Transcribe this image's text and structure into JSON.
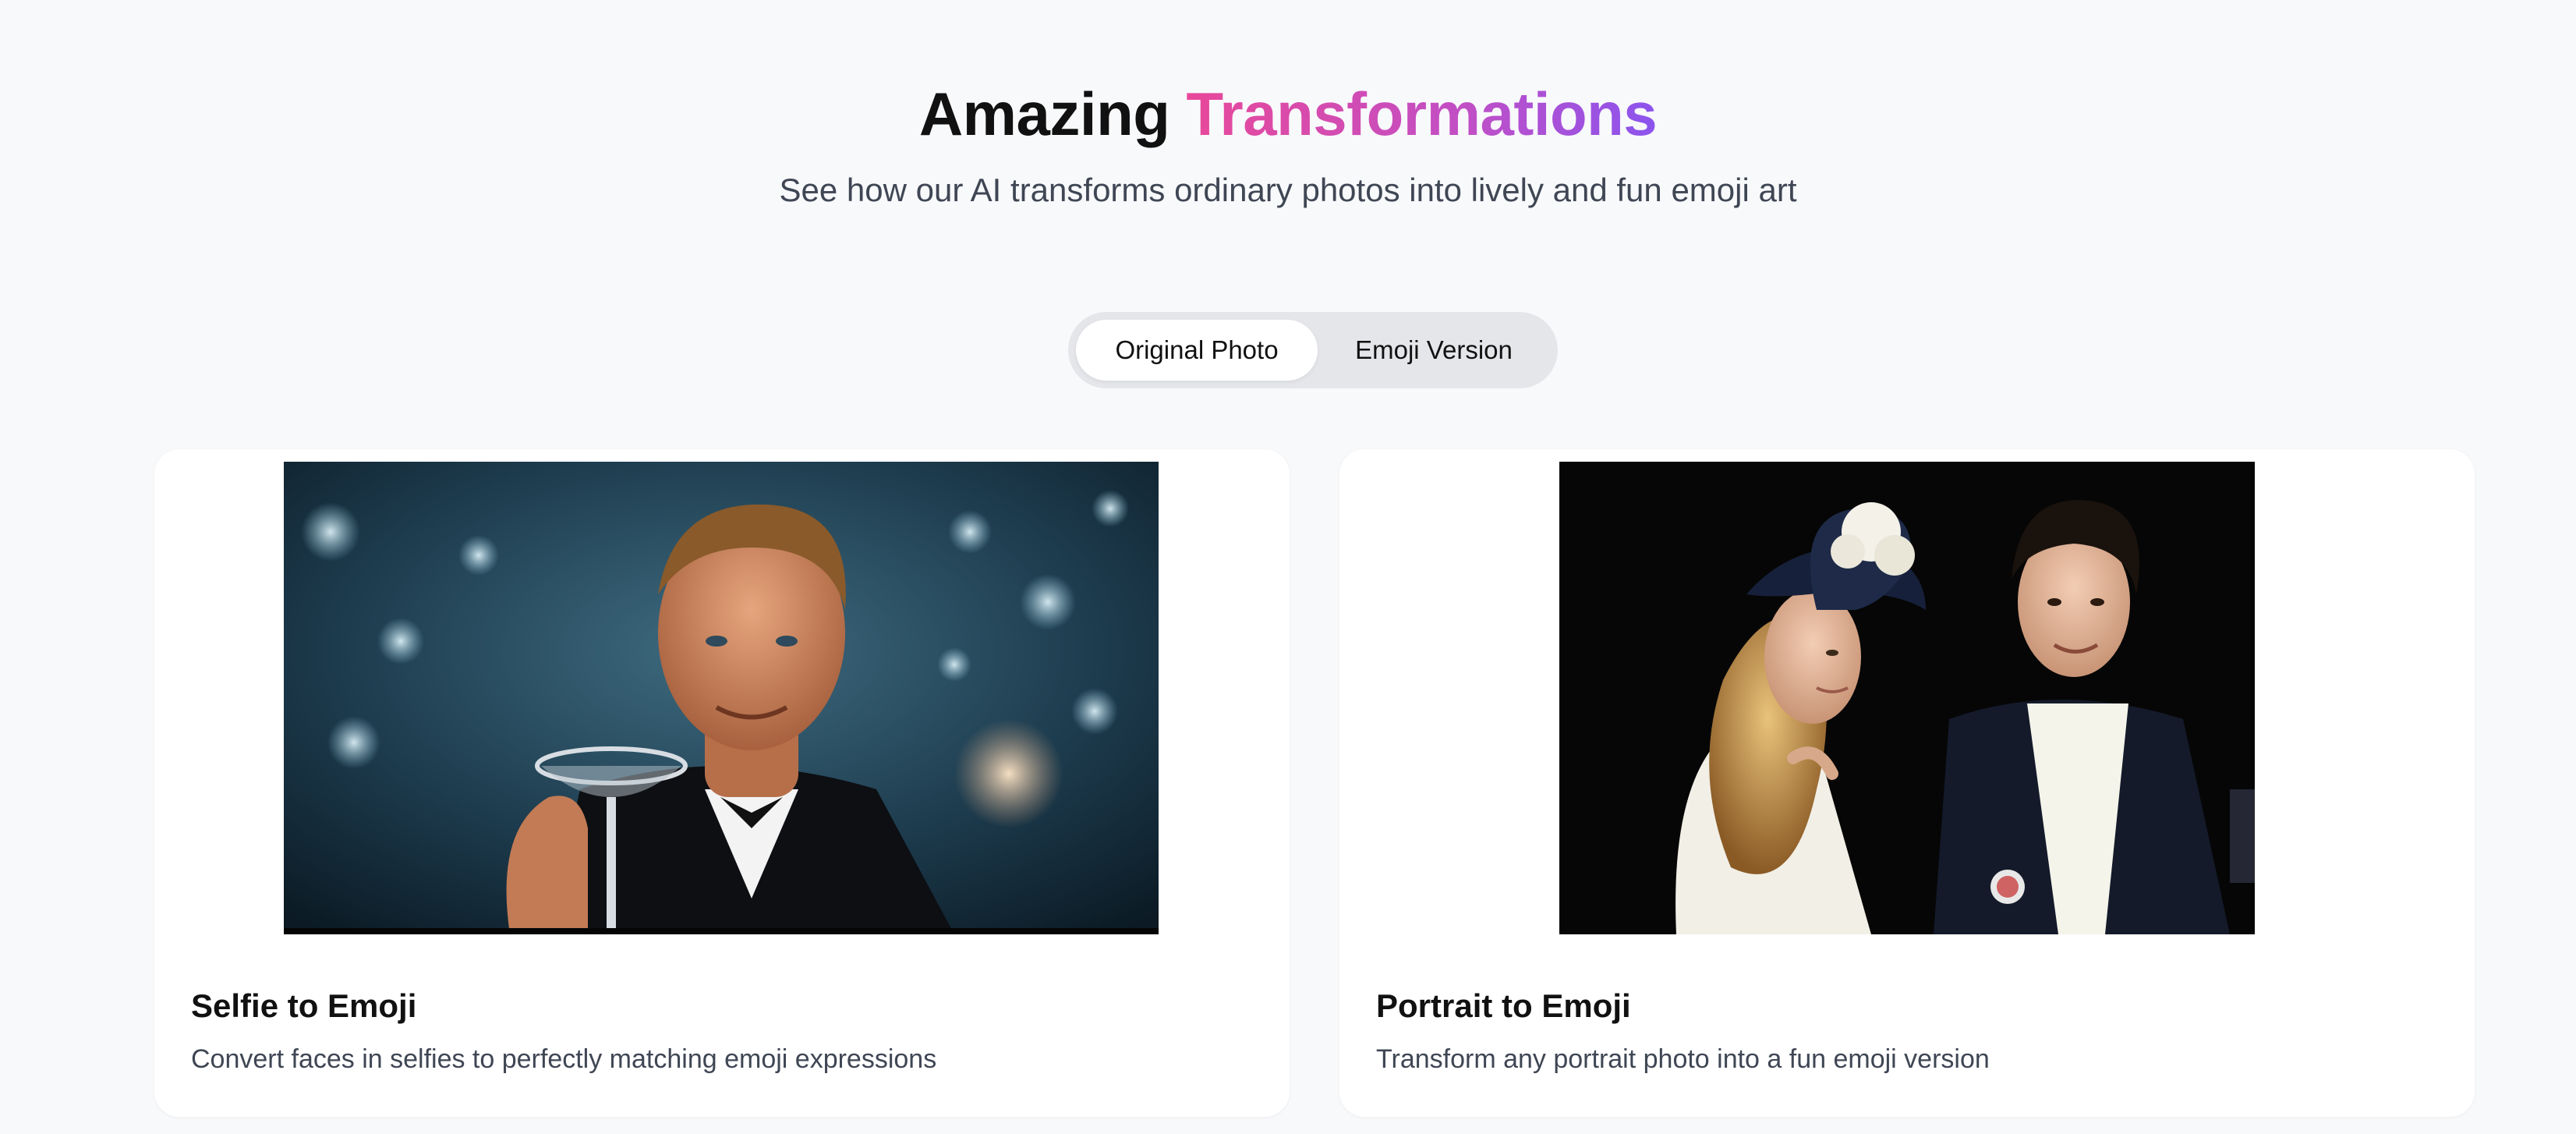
{
  "hero": {
    "title_plain": "Amazing",
    "title_accent": "Transformations",
    "subtitle": "See how our AI transforms ordinary photos into lively and fun emoji art"
  },
  "toggle": {
    "options": [
      "Original Photo",
      "Emoji Version"
    ],
    "selected": "Original Photo"
  },
  "cards": [
    {
      "title": "Selfie to Emoji",
      "description": "Convert faces in selfies to perfectly matching emoji expressions"
    },
    {
      "title": "Portrait to Emoji",
      "description": "Transform any portrait photo into a fun emoji version"
    }
  ],
  "colors": {
    "accent_start": "#e8489a",
    "accent_end": "#8b54ee",
    "background": "#f8f9fb",
    "toggle_track": "#e5e6ea"
  }
}
